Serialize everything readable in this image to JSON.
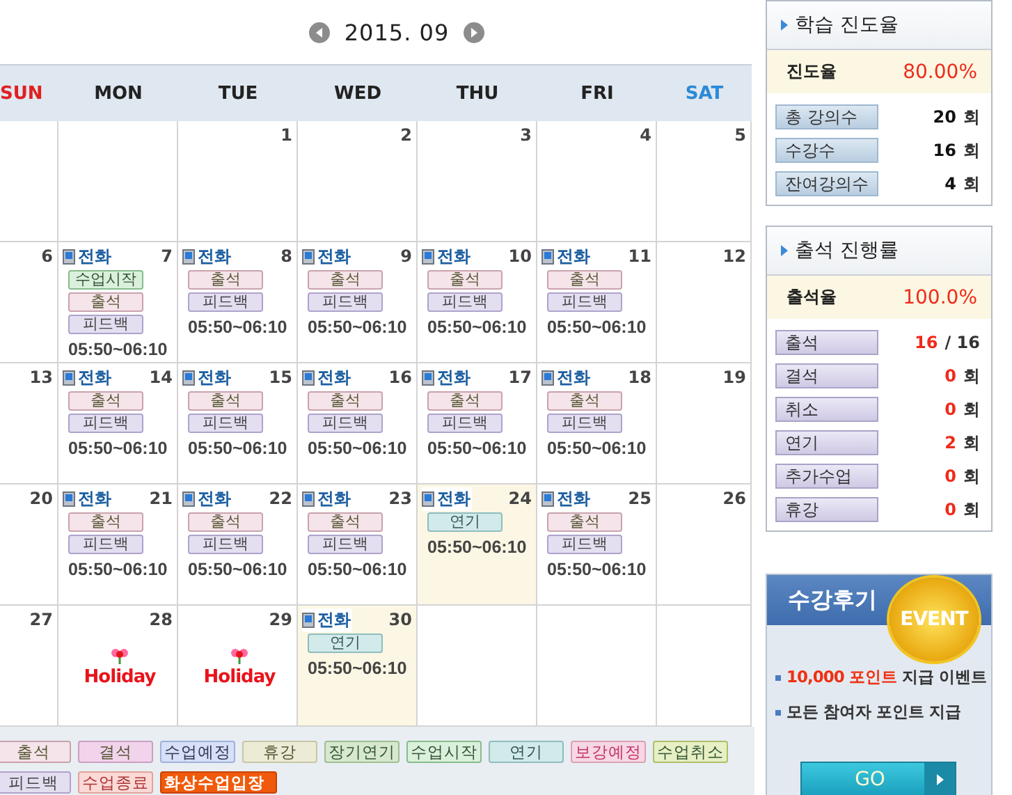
{
  "calendar": {
    "month": "2015. 09",
    "weekdays": [
      {
        "label": "SUN",
        "kind": "sun"
      },
      {
        "label": "MON",
        "kind": "weekday"
      },
      {
        "label": "TUE",
        "kind": "weekday"
      },
      {
        "label": "WED",
        "kind": "weekday"
      },
      {
        "label": "THU",
        "kind": "weekday"
      },
      {
        "label": "FRI",
        "kind": "weekday"
      },
      {
        "label": "SAT",
        "kind": "sat"
      }
    ],
    "weeks": [
      {
        "days": [
          {
            "highlighted": false
          },
          {
            "highlighted": false
          },
          {
            "number": "1",
            "highlighted": false
          },
          {
            "number": "2",
            "highlighted": false
          },
          {
            "number": "3",
            "highlighted": false
          },
          {
            "number": "4",
            "highlighted": false
          },
          {
            "number": "5",
            "highlighted": false
          }
        ]
      },
      {
        "days": [
          {
            "number": "6",
            "highlighted": false
          },
          {
            "number": "7",
            "call": "전화",
            "tags": [
              {
                "label": "수업시작",
                "kind": "start"
              },
              {
                "label": "출석",
                "kind": "attend"
              },
              {
                "label": "피드백",
                "kind": "feedback"
              }
            ],
            "time": "05:50~06:10",
            "highlighted": false
          },
          {
            "number": "8",
            "call": "전화",
            "tags": [
              {
                "label": "출석",
                "kind": "attend"
              },
              {
                "label": "피드백",
                "kind": "feedback"
              }
            ],
            "time": "05:50~06:10",
            "highlighted": false
          },
          {
            "number": "9",
            "call": "전화",
            "tags": [
              {
                "label": "출석",
                "kind": "attend"
              },
              {
                "label": "피드백",
                "kind": "feedback"
              }
            ],
            "time": "05:50~06:10",
            "highlighted": false
          },
          {
            "number": "10",
            "call": "전화",
            "tags": [
              {
                "label": "출석",
                "kind": "attend"
              },
              {
                "label": "피드백",
                "kind": "feedback"
              }
            ],
            "time": "05:50~06:10",
            "highlighted": false
          },
          {
            "number": "11",
            "call": "전화",
            "tags": [
              {
                "label": "출석",
                "kind": "attend"
              },
              {
                "label": "피드백",
                "kind": "feedback"
              }
            ],
            "time": "05:50~06:10",
            "highlighted": false
          },
          {
            "number": "12",
            "highlighted": false
          }
        ]
      },
      {
        "days": [
          {
            "number": "13",
            "highlighted": false
          },
          {
            "number": "14",
            "call": "전화",
            "tags": [
              {
                "label": "출석",
                "kind": "attend"
              },
              {
                "label": "피드백",
                "kind": "feedback"
              }
            ],
            "time": "05:50~06:10",
            "highlighted": false
          },
          {
            "number": "15",
            "call": "전화",
            "tags": [
              {
                "label": "출석",
                "kind": "attend"
              },
              {
                "label": "피드백",
                "kind": "feedback"
              }
            ],
            "time": "05:50~06:10",
            "highlighted": false
          },
          {
            "number": "16",
            "call": "전화",
            "tags": [
              {
                "label": "출석",
                "kind": "attend"
              },
              {
                "label": "피드백",
                "kind": "feedback"
              }
            ],
            "time": "05:50~06:10",
            "highlighted": false
          },
          {
            "number": "17",
            "call": "전화",
            "tags": [
              {
                "label": "출석",
                "kind": "attend"
              },
              {
                "label": "피드백",
                "kind": "feedback"
              }
            ],
            "time": "05:50~06:10",
            "highlighted": false
          },
          {
            "number": "18",
            "call": "전화",
            "tags": [
              {
                "label": "출석",
                "kind": "attend"
              },
              {
                "label": "피드백",
                "kind": "feedback"
              }
            ],
            "time": "05:50~06:10",
            "highlighted": false
          },
          {
            "number": "19",
            "highlighted": false
          }
        ]
      },
      {
        "days": [
          {
            "number": "20",
            "highlighted": false
          },
          {
            "number": "21",
            "call": "전화",
            "tags": [
              {
                "label": "출석",
                "kind": "attend"
              },
              {
                "label": "피드백",
                "kind": "feedback"
              }
            ],
            "time": "05:50~06:10",
            "highlighted": false
          },
          {
            "number": "22",
            "call": "전화",
            "tags": [
              {
                "label": "출석",
                "kind": "attend"
              },
              {
                "label": "피드백",
                "kind": "feedback"
              }
            ],
            "time": "05:50~06:10",
            "highlighted": false
          },
          {
            "number": "23",
            "call": "전화",
            "tags": [
              {
                "label": "출석",
                "kind": "attend"
              },
              {
                "label": "피드백",
                "kind": "feedback"
              }
            ],
            "time": "05:50~06:10",
            "highlighted": false
          },
          {
            "number": "24",
            "call": "전화",
            "tags": [
              {
                "label": "연기",
                "kind": "postpone"
              }
            ],
            "time": "05:50~06:10",
            "highlighted": true
          },
          {
            "number": "25",
            "call": "전화",
            "tags": [
              {
                "label": "출석",
                "kind": "attend"
              },
              {
                "label": "피드백",
                "kind": "feedback"
              }
            ],
            "time": "05:50~06:10",
            "highlighted": false
          },
          {
            "number": "26",
            "highlighted": false
          }
        ]
      },
      {
        "days": [
          {
            "number": "27",
            "highlighted": false
          },
          {
            "number": "28",
            "holiday": "Holiday",
            "highlighted": false
          },
          {
            "number": "29",
            "holiday": "Holiday",
            "highlighted": false
          },
          {
            "number": "30",
            "call": "전화",
            "tags": [
              {
                "label": "연기",
                "kind": "postpone"
              }
            ],
            "time": "05:50~06:10",
            "highlighted": true
          },
          {
            "highlighted": false
          },
          {
            "highlighted": false
          },
          {
            "highlighted": false
          }
        ]
      }
    ],
    "legend": [
      {
        "label": "출석",
        "kind": "attend"
      },
      {
        "label": "결석",
        "kind": "absent"
      },
      {
        "label": "수업예정",
        "kind": "scheduled"
      },
      {
        "label": "휴강",
        "kind": "break"
      },
      {
        "label": "장기연기",
        "kind": "longpostpone"
      },
      {
        "label": "수업시작",
        "kind": "start"
      },
      {
        "label": "연기",
        "kind": "postpone"
      },
      {
        "label": "보강예정",
        "kind": "makeup"
      },
      {
        "label": "수업취소",
        "kind": "cancel"
      },
      {
        "label": "피드백",
        "kind": "feedback"
      },
      {
        "label": "수업종료",
        "kind": "end"
      },
      {
        "label": "화상수업입장",
        "kind": "video"
      }
    ]
  },
  "boxes": [
    {
      "kind": "progress",
      "title": "학습 진도율",
      "rate_label": "진도율",
      "rate": "80.00%",
      "stats": [
        {
          "label": "총 강의수",
          "value": "20",
          "unit": "회"
        },
        {
          "label": "수강수",
          "value": "16",
          "unit": "회"
        },
        {
          "label": "잔여강의수",
          "value": "4",
          "unit": "회"
        }
      ]
    },
    {
      "kind": "attendance",
      "title": "출석 진행률",
      "rate_label": "출석율",
      "rate": "100.0%",
      "stats": [
        {
          "label": "출석",
          "value": "16",
          "unit": "/ 16"
        },
        {
          "label": "결석",
          "value": "0",
          "unit": "회"
        },
        {
          "label": "취소",
          "value": "0",
          "unit": "회"
        },
        {
          "label": "연기",
          "value": "2",
          "unit": "회"
        },
        {
          "label": "추가수업",
          "value": "0",
          "unit": "회"
        },
        {
          "label": "휴강",
          "value": "0",
          "unit": "회"
        }
      ]
    }
  ],
  "event": {
    "title": "수강후기",
    "badge": "EVENT",
    "lines": [
      "**10,000 포인트** 지급 이벤트",
      "모든 참여자 포인트 지급"
    ],
    "button": "GO"
  }
}
